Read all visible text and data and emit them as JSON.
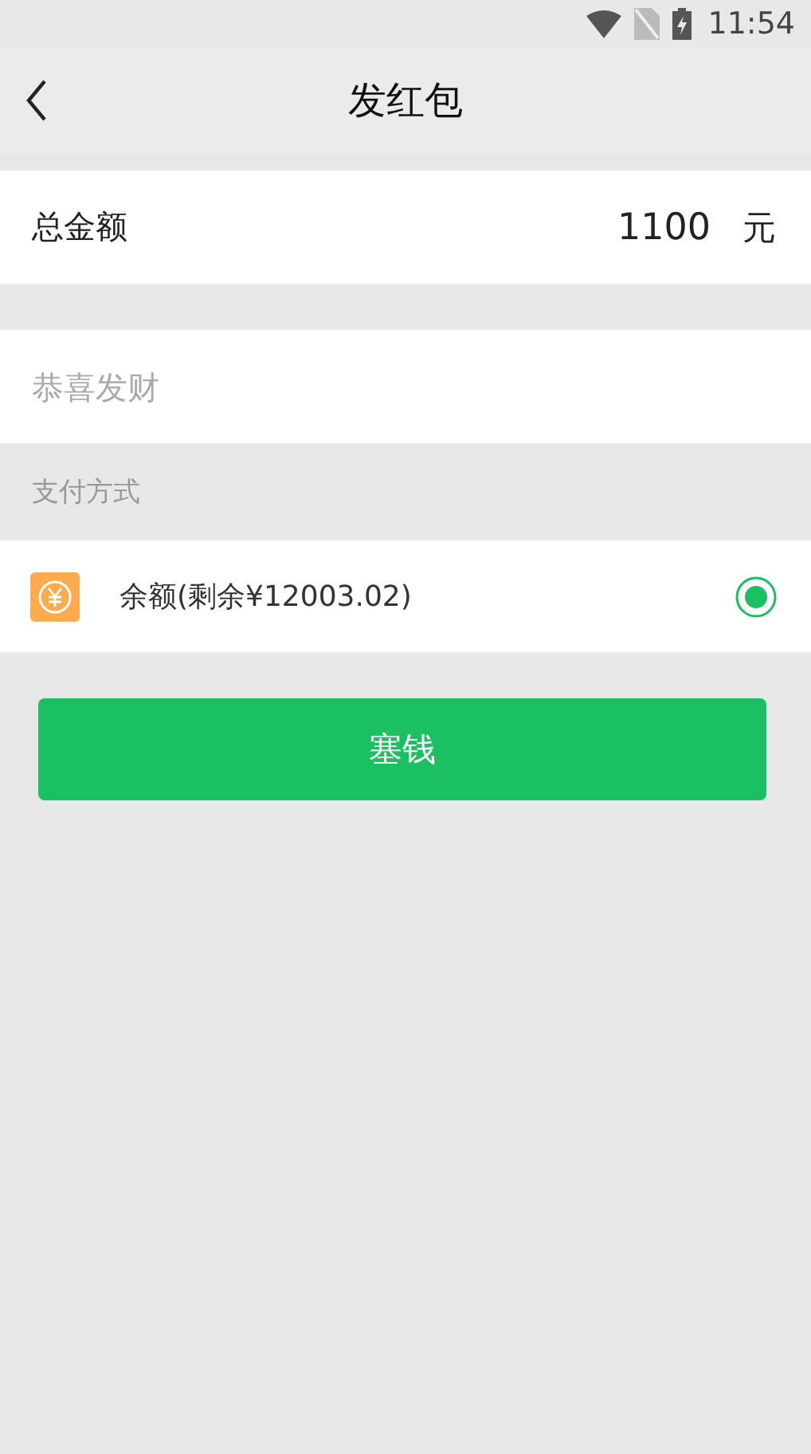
{
  "status_bar": {
    "time": "11:54"
  },
  "header": {
    "title": "发红包"
  },
  "amount": {
    "label": "总金额",
    "value": "1100",
    "unit": "元"
  },
  "greeting": {
    "placeholder": "恭喜发财"
  },
  "payment": {
    "section_label": "支付方式",
    "methods": [
      {
        "label": "余额(剩余¥12003.02)",
        "selected": true
      }
    ]
  },
  "submit_button": "塞钱"
}
